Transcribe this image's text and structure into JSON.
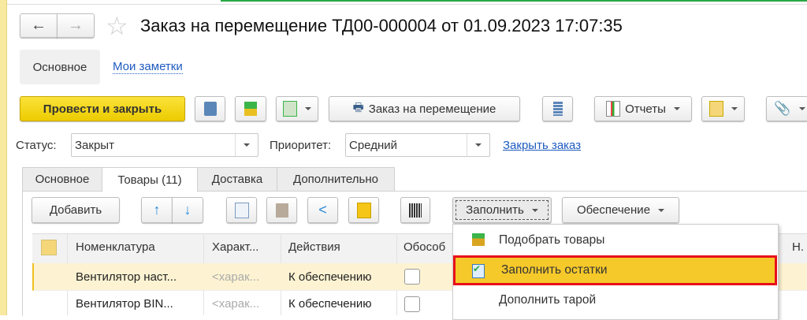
{
  "title": "Заказ на перемещение ТД00-000004 от 01.09.2023 17:07:35",
  "nav": {
    "main": "Основное",
    "notes": "Мои заметки"
  },
  "toolbar": {
    "post_close": "Провести и закрыть",
    "print": "Заказ на перемещение",
    "reports": "Отчеты"
  },
  "status": {
    "label": "Статус:",
    "value": "Закрыт",
    "priority_label": "Приоритет:",
    "priority_value": "Средний",
    "close_link": "Закрыть заказ"
  },
  "tabs": [
    "Основное",
    "Товары (11)",
    "Доставка",
    "Дополнительно"
  ],
  "goods_toolbar": {
    "add": "Добавить",
    "fill": "Заполнить",
    "supply": "Обеспечение"
  },
  "table": {
    "columns": [
      "Номенклатура",
      "Характ...",
      "Действия",
      "Обособ",
      "Н."
    ],
    "rows": [
      {
        "item": "Вентилятор наст...",
        "char": "<харак...",
        "action": "К обеспечению"
      },
      {
        "item": "Вентилятор BIN...",
        "char": "<харак...",
        "action": "К обеспечению"
      }
    ]
  },
  "menu": {
    "items": [
      "Подобрать товары",
      "Заполнить остатки",
      "Дополнить тарой"
    ],
    "selected": 1
  },
  "colors": {
    "accent": "#f5d40f",
    "highlight": "#f6c92a",
    "row": "#fdf3d2",
    "link": "#1f5bbf"
  }
}
